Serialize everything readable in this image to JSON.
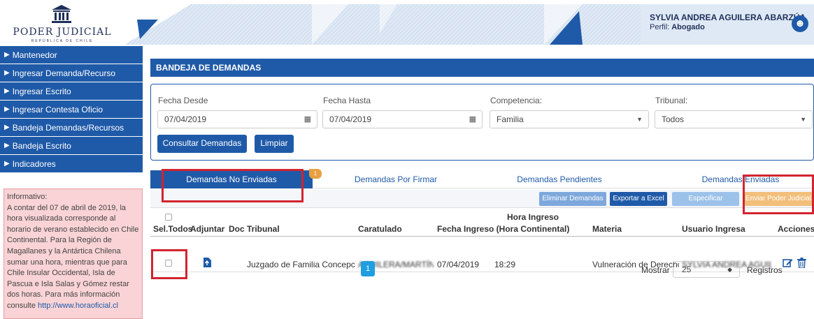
{
  "header": {
    "logo_name": "PODER JUDICIAL",
    "logo_sub": "REPÚBLICA DE CHILE",
    "user_name": "SYLVIA ANDREA AGUILERA ABARZÚA",
    "profile_label": "Perfil:",
    "profile_value": "Abogado"
  },
  "sidebar": {
    "items": [
      {
        "label": "Mantenedor"
      },
      {
        "label": "Ingresar Demanda/Recurso"
      },
      {
        "label": "Ingresar Escrito"
      },
      {
        "label": "Ingresar Contesta Oficio"
      },
      {
        "label": "Bandeja Demandas/Recursos"
      },
      {
        "label": "Bandeja Escrito"
      },
      {
        "label": "Indicadores"
      }
    ],
    "info_title": "Informativo:",
    "info_text": "A contar del 07 de abril de 2019, la hora visualizada corresponde al horario de verano establecido en Chile Continental. Para la Región de Magallanes y la Antártica Chilena sumar una hora, mientras que para Chile Insular Occidental, Isla de Pascua e Isla Salas y Gómez restar dos horas. Para más información consulte",
    "info_link": "http://www.horaoficial.cl"
  },
  "panel": {
    "title": "BANDEJA DE DEMANDAS"
  },
  "filters": {
    "fecha_desde_label": "Fecha Desde",
    "fecha_desde_value": "07/04/2019",
    "fecha_hasta_label": "Fecha Hasta",
    "fecha_hasta_value": "07/04/2019",
    "competencia_label": "Competencia:",
    "competencia_value": "Familia",
    "tribunal_label": "Tribunal:",
    "tribunal_value": "Todos",
    "consultar_label": "Consultar Demandas",
    "limpiar_label": "Limpiar"
  },
  "tabs": [
    {
      "label": "Demandas No Enviadas",
      "badge": "1"
    },
    {
      "label": "Demandas Por Firmar"
    },
    {
      "label": "Demandas Pendientes"
    },
    {
      "label": "Demandas Enviadas"
    }
  ],
  "toolbar": {
    "eliminar": "Eliminar Demandas",
    "exportar": "Exportar a Excel",
    "especificar": "Especificar Firmantes",
    "enviar": "Enviar Poder Judicial"
  },
  "table": {
    "headers": {
      "sel": "Sel.Todos",
      "adjuntar": "Adjuntar",
      "doc": "Doc",
      "tribunal": "Tribunal",
      "caratulado": "Caratulado",
      "fecha": "Fecha Ingreso",
      "hora_1": "Hora Ingreso",
      "hora_2": "(Hora Continental)",
      "materia": "Materia",
      "usuario": "Usuario Ingresa",
      "acciones": "Acciones"
    },
    "rows": [
      {
        "tribunal": "Juzgado de Familia Concepción",
        "caratulado": "AGUILERA/MARTÍNEZ",
        "fecha": "07/04/2019",
        "hora": "18:29",
        "materia": "Vulneración de Derechos",
        "usuario": "SYLVIA ANDREA AGUILERA"
      }
    ]
  },
  "pagination": {
    "page": "1",
    "mostrar_label": "Mostrar",
    "mostrar_value": "25",
    "registros_label": "Registros"
  },
  "colors": {
    "primary": "#1f5aa8",
    "highlight": "#d2242f",
    "info_bg": "#f9d3d5",
    "badge": "#e8a040"
  }
}
